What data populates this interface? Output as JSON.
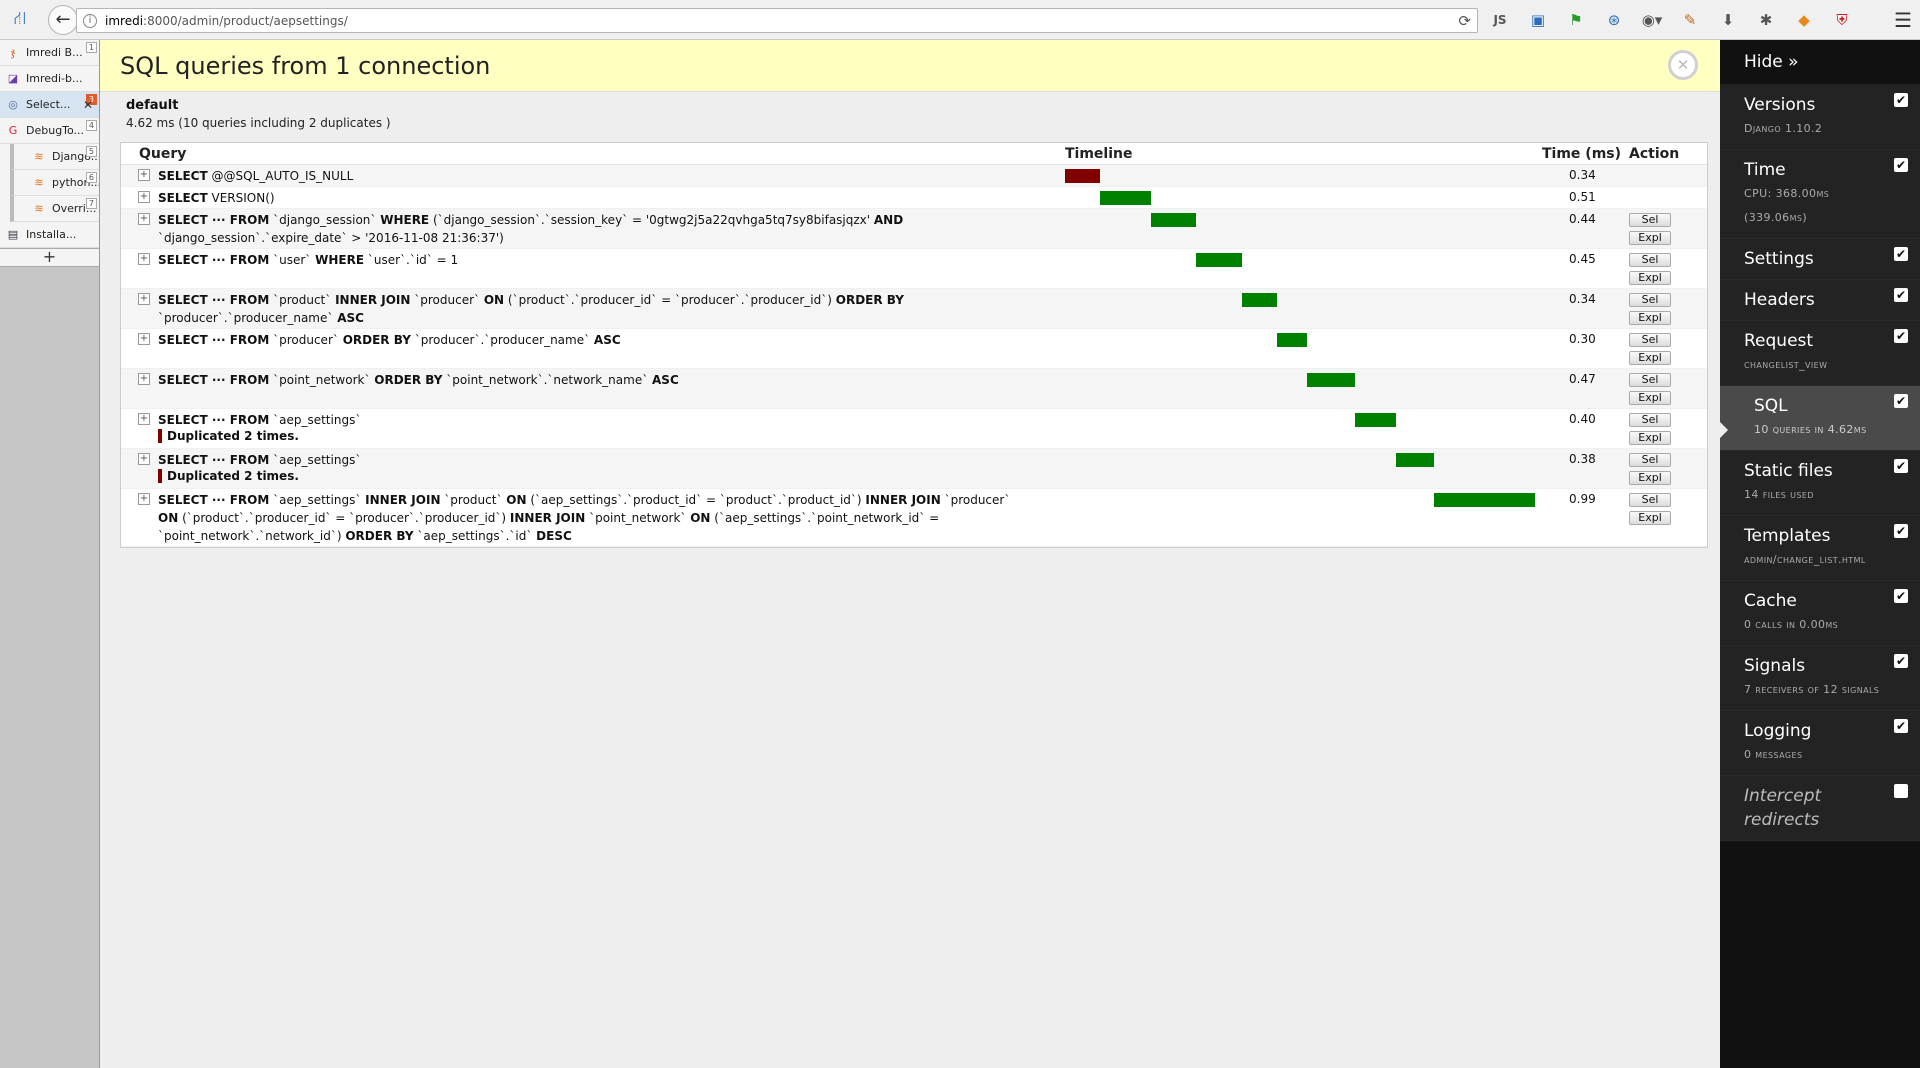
{
  "browser": {
    "url_host": "imredi",
    "url_rest": ":8000/admin/product/aepsettings/",
    "toolbar_icons": [
      "js-icon",
      "screenshot-icon",
      "flag-icon",
      "network-icon",
      "globe-icon",
      "extension-icon",
      "download-icon",
      "puzzle-icon",
      "fox-icon",
      "shield-icon"
    ],
    "js_label": "JS"
  },
  "tabs": [
    {
      "label": "Imredi B...",
      "num": "1",
      "icon": "ჯ",
      "color": "#e05a2a",
      "child": false,
      "active": false
    },
    {
      "label": "Imredi-b...",
      "num": "",
      "icon": "◪",
      "color": "#6a3db0",
      "child": false,
      "active": false
    },
    {
      "label": "Select...",
      "num": "3",
      "icon": "◎",
      "color": "#4a6a9a",
      "child": false,
      "active": true
    },
    {
      "label": "DebugTo...",
      "num": "4",
      "icon": "G",
      "color": "#d23",
      "child": false,
      "active": false
    },
    {
      "label": "Django...",
      "num": "5",
      "icon": "≋",
      "color": "#e8761a",
      "child": true,
      "active": false
    },
    {
      "label": "python...",
      "num": "6",
      "icon": "≋",
      "color": "#e8761a",
      "child": true,
      "active": false
    },
    {
      "label": "Overri...",
      "num": "7",
      "icon": "≋",
      "color": "#e8761a",
      "child": true,
      "active": false
    },
    {
      "label": "Installa...",
      "num": "",
      "icon": "▤",
      "color": "#334",
      "child": false,
      "active": false
    }
  ],
  "panel": {
    "title": "SQL queries from 1 connection",
    "db_name": "default",
    "db_stats": "4.62 ms (10 queries including 2 duplicates )",
    "headers": {
      "query": "Query",
      "timeline": "Timeline",
      "time": "Time (ms)",
      "action": "Action"
    },
    "sel_label": "Sel",
    "expl_label": "Expl",
    "duplicate_label": "Duplicated 2 times."
  },
  "queries": [
    {
      "html": "<b>SELECT</b> @@SQL_AUTO_IS_NULL",
      "time": "0.34",
      "actions": false,
      "dup": false,
      "start_ms": 0.0,
      "color": "#800000"
    },
    {
      "html": "<b>SELECT</b> VERSION()",
      "time": "0.51",
      "actions": false,
      "dup": false,
      "start_ms": 0.34,
      "color": "#008000"
    },
    {
      "html": "<b>SELECT ··· FROM</b> `django_session` <b>WHERE</b> (`django_session`.`session_key` = '0gtwg2j5a22qvhga5tq7sy8bifasjqzx' <b>AND</b><br>`django_session`.`expire_date` &gt; '2016-11-08 21:36:37')",
      "time": "0.44",
      "actions": true,
      "dup": false,
      "start_ms": 0.85,
      "color": "#008000"
    },
    {
      "html": "<b>SELECT ··· FROM</b> `user` <b>WHERE</b> `user`.`id` = 1",
      "time": "0.45",
      "actions": true,
      "dup": false,
      "start_ms": 1.29,
      "color": "#008000"
    },
    {
      "html": "<b>SELECT ··· FROM</b> `product` <b>INNER JOIN</b> `producer` <b>ON</b> (`product`.`producer_id` = `producer`.`producer_id`) <b>ORDER BY</b><br>`producer`.`producer_name` <b>ASC</b>",
      "time": "0.34",
      "actions": true,
      "dup": false,
      "start_ms": 1.74,
      "color": "#008000"
    },
    {
      "html": "<b>SELECT ··· FROM</b> `producer` <b>ORDER BY</b> `producer`.`producer_name` <b>ASC</b>",
      "time": "0.30",
      "actions": true,
      "dup": false,
      "start_ms": 2.08,
      "color": "#008000"
    },
    {
      "html": "<b>SELECT ··· FROM</b> `point_network` <b>ORDER BY</b> `point_network`.`network_name` <b>ASC</b>",
      "time": "0.47",
      "actions": true,
      "dup": false,
      "start_ms": 2.38,
      "color": "#008000"
    },
    {
      "html": "<b>SELECT ··· FROM</b> `aep_settings`",
      "time": "0.40",
      "actions": true,
      "dup": true,
      "start_ms": 2.85,
      "color": "#008000"
    },
    {
      "html": "<b>SELECT ··· FROM</b> `aep_settings`",
      "time": "0.38",
      "actions": true,
      "dup": true,
      "start_ms": 3.25,
      "color": "#008000"
    },
    {
      "html": "<b>SELECT ··· FROM</b> `aep_settings` <b>INNER JOIN</b> `product` <b>ON</b> (`aep_settings`.`product_id` = `product`.`product_id`) <b>INNER JOIN</b> `producer`<br><b>ON</b> (`product`.`producer_id` = `producer`.`producer_id`) <b>INNER JOIN</b> `point_network` <b>ON</b> (`aep_settings`.`point_network_id` =<br>`point_network`.`network_id`) <b>ORDER BY</b> `aep_settings`.`id` <b>DESC</b>",
      "time": "0.99",
      "actions": true,
      "dup": false,
      "start_ms": 3.63,
      "color": "#008000"
    }
  ],
  "djdt": {
    "hide_label": "Hide »",
    "items": [
      {
        "title": "Versions",
        "sub": "Django 1.10.2",
        "checked": true
      },
      {
        "title": "Time",
        "sub": "CPU: 368.00ms (339.06ms)",
        "checked": true
      },
      {
        "title": "Settings",
        "sub": "",
        "checked": true
      },
      {
        "title": "Headers",
        "sub": "",
        "checked": true
      },
      {
        "title": "Request",
        "sub": "changelist_view",
        "checked": true
      },
      {
        "title": "SQL",
        "sub": "10 queries in 4.62ms",
        "checked": true,
        "active": true
      },
      {
        "title": "Static files",
        "sub": "14 files used",
        "checked": true
      },
      {
        "title": "Templates",
        "sub": "admin/change_list.html",
        "checked": true
      },
      {
        "title": "Cache",
        "sub": "0 calls in 0.00ms",
        "checked": true
      },
      {
        "title": "Signals",
        "sub": "7 receivers of 12 signals",
        "checked": true
      },
      {
        "title": "Logging",
        "sub": "0 messages",
        "checked": true
      },
      {
        "title": "Intercept redirects",
        "sub": "",
        "checked": false,
        "italic": true
      }
    ]
  }
}
